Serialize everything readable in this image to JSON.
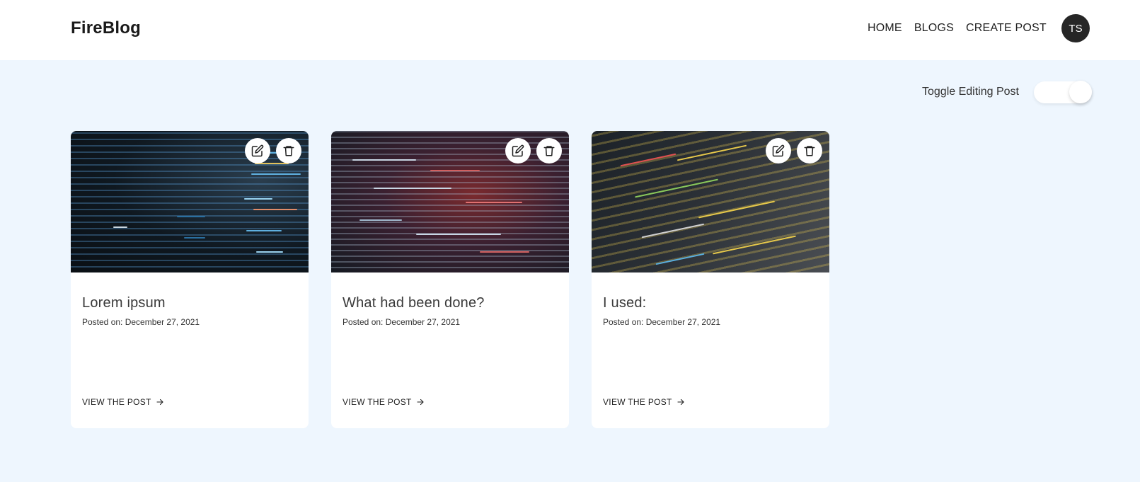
{
  "header": {
    "brand": "FireBlog",
    "nav": [
      "HOME",
      "BLOGS",
      "CREATE POST"
    ],
    "avatar_initials": "TS"
  },
  "toolbar": {
    "toggle_label": "Toggle Editing Post",
    "toggle_on": true
  },
  "posts": [
    {
      "title": "Lorem ipsum",
      "date": "Posted on: December 27, 2021",
      "link": "VIEW THE POST",
      "image": "code-screen-blue"
    },
    {
      "title": "What had been done?",
      "date": "Posted on: December 27, 2021",
      "link": "VIEW THE POST",
      "image": "code-screen-red"
    },
    {
      "title": "I used:",
      "date": "Posted on: December 27, 2021",
      "link": "VIEW THE POST",
      "image": "code-screen-yellow"
    }
  ],
  "icons": {
    "edit": "edit-icon",
    "delete": "trash-icon",
    "arrow": "arrow-right-icon"
  },
  "colors": {
    "page_bg": "#eef6fe",
    "header_bg": "#ffffff",
    "avatar_bg": "#262626"
  }
}
